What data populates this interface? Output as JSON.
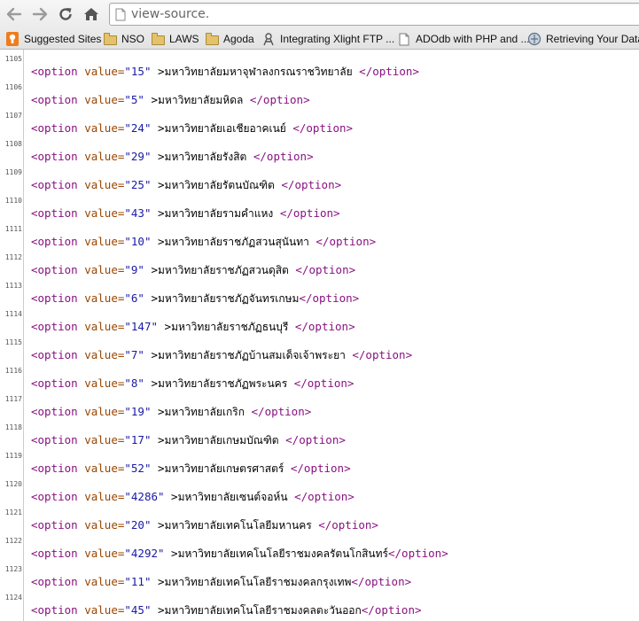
{
  "toolbar": {
    "address": "view-source.",
    "back_icon": "arrow-left-icon",
    "forward_icon": "arrow-right-icon",
    "reload_icon": "reload-icon",
    "home_icon": "home-icon"
  },
  "bookmarks": [
    {
      "label": "Suggested Sites",
      "icon": "suggested-sites-icon"
    },
    {
      "label": "NSO",
      "icon": "folder-icon"
    },
    {
      "label": "LAWS",
      "icon": "folder-icon"
    },
    {
      "label": "Agoda",
      "icon": "folder-icon"
    },
    {
      "label": "Integrating Xlight FTP ...",
      "icon": "xlight-icon"
    },
    {
      "label": "ADOdb with PHP and ...",
      "icon": "page-icon"
    },
    {
      "label": "Retrieving Your Data :",
      "icon": "site-icon"
    }
  ],
  "source": {
    "tag_open": "<option",
    "attr_name": "value=",
    "tag_close": "</option>",
    "lines": [
      {
        "n": "1105",
        "value": "\"15\"",
        "text": "มหาวิทยาลัยมหาจุฬาลงกรณราชวิทยาลัย",
        "space": true
      },
      {
        "n": "1106",
        "value": "\"5\"",
        "text": "มหาวิทยาลัยมหิดล",
        "space": true
      },
      {
        "n": "1107",
        "value": "\"24\"",
        "text": "มหาวิทยาลัยเอเชียอาคเนย์",
        "space": true
      },
      {
        "n": "1108",
        "value": "\"29\"",
        "text": "มหาวิทยาลัยรังสิต",
        "space": true
      },
      {
        "n": "1109",
        "value": "\"25\"",
        "text": "มหาวิทยาลัยรัตนบัณฑิต",
        "space": true
      },
      {
        "n": "1110",
        "value": "\"43\"",
        "text": "มหาวิทยาลัยรามคำแหง",
        "space": true
      },
      {
        "n": "1111",
        "value": "\"10\"",
        "text": "มหาวิทยาลัยราชภัฏสวนสุนันทา",
        "space": true
      },
      {
        "n": "1112",
        "value": "\"9\"",
        "text": "มหาวิทยาลัยราชภัฏสวนดุสิต",
        "space": true
      },
      {
        "n": "1113",
        "value": "\"6\"",
        "text": "มหาวิทยาลัยราชภัฏจันทรเกษม",
        "space": false
      },
      {
        "n": "1114",
        "value": "\"147\"",
        "text": "มหาวิทยาลัยราชภัฏธนบุรี",
        "space": true
      },
      {
        "n": "1115",
        "value": "\"7\"",
        "text": "มหาวิทยาลัยราชภัฏบ้านสมเด็จเจ้าพระยา",
        "space": true
      },
      {
        "n": "1116",
        "value": "\"8\"",
        "text": "มหาวิทยาลัยราชภัฏพระนคร",
        "space": true
      },
      {
        "n": "1117",
        "value": "\"19\"",
        "text": "มหาวิทยาลัยเกริก",
        "space": true
      },
      {
        "n": "1118",
        "value": "\"17\"",
        "text": "มหาวิทยาลัยเกษมบัณฑิต",
        "space": true
      },
      {
        "n": "1119",
        "value": "\"52\"",
        "text": "มหาวิทยาลัยเกษตรศาสตร์",
        "space": true
      },
      {
        "n": "1120",
        "value": "\"4286\"",
        "text": "มหาวิทยาลัยเซนต์จอห์น",
        "space": true
      },
      {
        "n": "1121",
        "value": "\"20\"",
        "text": "มหาวิทยาลัยเทคโนโลยีมหานคร",
        "space": true
      },
      {
        "n": "1122",
        "value": "\"4292\"",
        "text": "มหาวิทยาลัยเทคโนโลยีราชมงคลรัตนโกสินทร์",
        "space": false
      },
      {
        "n": "1123",
        "value": "\"11\"",
        "text": "มหาวิทยาลัยเทคโนโลยีราชมงคลกรุงเทพ",
        "space": false
      },
      {
        "n": "1124",
        "value": "\"45\"",
        "text": "มหาวิทยาลัยเทคโนโลยีราชมงคลตะวันออก",
        "space": false
      }
    ]
  }
}
